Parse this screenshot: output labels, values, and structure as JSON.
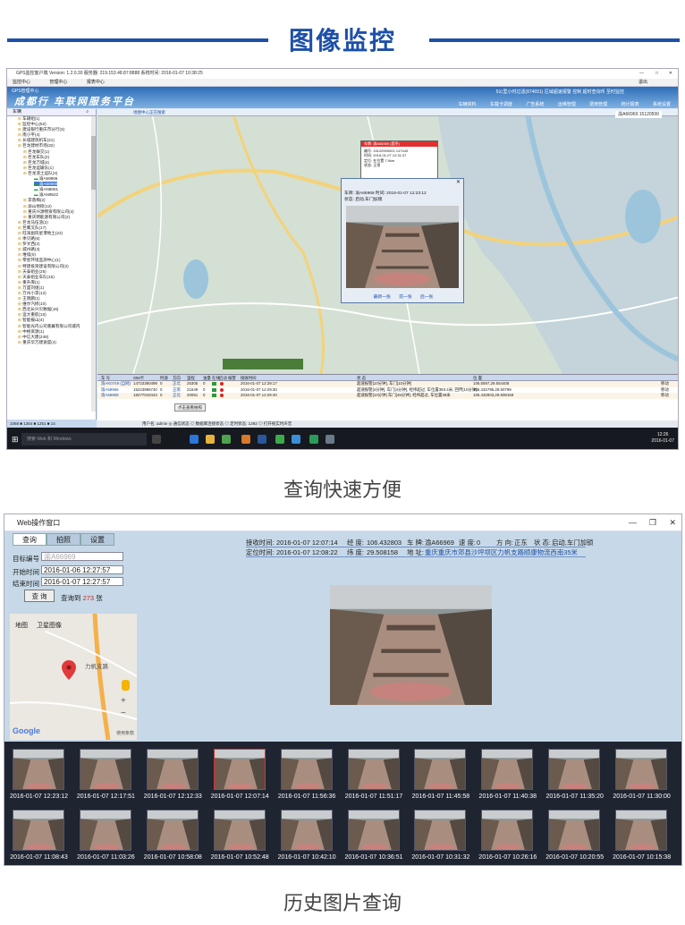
{
  "header": {
    "title": "图像监控"
  },
  "captions": {
    "top": "查询快速方便",
    "bottom": "历史图片查询"
  },
  "app1": {
    "title": "GPS监控客户端  Version: 1.2.0.30  服务器: 219.153.48.87:8888  系统时间: 2016-01-07 10:38:25",
    "menu": [
      "监控中心",
      "管理中心",
      "报表中心"
    ],
    "menu_right": "退出",
    "banner_logo": "成都行 车联网服务平台",
    "banner_sub": "GPS管理中心",
    "banner_links": "5公里小时过滤(874651) 区域超速报警  控制 超时查询币 至时监控",
    "banner_tabs": [
      "车辆资料",
      "车载卡调度",
      "广告系统",
      "运维管理",
      "费用管理",
      "统计报表",
      "系统设置"
    ],
    "tree_search": "车辆",
    "tree": [
      {
        "lvl": 1,
        "t": "车辆组(1)"
      },
      {
        "lvl": 1,
        "t": "监控中心(52)"
      },
      {
        "lvl": 1,
        "t": "建设银行重庆市分行(3)"
      },
      {
        "lvl": 1,
        "t": "南小平(4)"
      },
      {
        "lvl": 1,
        "t": "长城建筑机车(21)"
      },
      {
        "lvl": 1,
        "t": "巨龙建材市场(32)"
      },
      {
        "lvl": 2,
        "t": "巨龙联交(1)"
      },
      {
        "lvl": 2,
        "t": "巨龙车队(2)"
      },
      {
        "lvl": 2,
        "t": "巨龙万城(4)"
      },
      {
        "lvl": 2,
        "t": "巨龙运输队(1)"
      },
      {
        "lvl": 2,
        "t": "巨龙渣土运队(4)"
      },
      {
        "lvl": 3,
        "t": "渝A59966"
      },
      {
        "lvl": 3,
        "t": "渝A66969",
        "sel": true
      },
      {
        "lvl": 3,
        "t": "渝AN8061"
      },
      {
        "lvl": 3,
        "t": "渝AN9522"
      },
      {
        "lvl": 2,
        "t": "李蓉梅(2)"
      },
      {
        "lvl": 2,
        "t": "渝山地街(12)"
      },
      {
        "lvl": 2,
        "t": "重庆兴源物资有限公司(4)"
      },
      {
        "lvl": 2,
        "t": "重庆明能源有限公司(2)"
      },
      {
        "lvl": 1,
        "t": "巨龙马伍渣(2)"
      },
      {
        "lvl": 1,
        "t": "巨鹰叉队(17)"
      },
      {
        "lvl": 1,
        "t": "旺泽副风星港地土(22)"
      },
      {
        "lvl": 1,
        "t": "季贝路(6)"
      },
      {
        "lvl": 1,
        "t": "罗文西(2)"
      },
      {
        "lvl": 1,
        "t": "城州路(3)"
      },
      {
        "lvl": 1,
        "t": "堆墙(0)"
      },
      {
        "lvl": 1,
        "t": "零星环境监测中心(1)"
      },
      {
        "lvl": 1,
        "t": "特建投资建设有限公司(2)"
      },
      {
        "lvl": 1,
        "t": "天泰组业(25)"
      },
      {
        "lvl": 1,
        "t": "天泰组业车队(15)"
      },
      {
        "lvl": 1,
        "t": "重升库(1)"
      },
      {
        "lvl": 1,
        "t": "万盛刘组(1)"
      },
      {
        "lvl": 1,
        "t": "万州小李(12)"
      },
      {
        "lvl": 1,
        "t": "王晓鹏(1)"
      },
      {
        "lvl": 1,
        "t": "维尔汽修(10)"
      },
      {
        "lvl": 1,
        "t": "西北长兴贝数据(16)"
      },
      {
        "lvl": 1,
        "t": "运大重航(10)"
      },
      {
        "lvl": 1,
        "t": "智能报山(4)"
      },
      {
        "lvl": 1,
        "t": "智能光内公司重翼有限公司城内"
      },
      {
        "lvl": 1,
        "t": "中格资源(1)"
      },
      {
        "lvl": 1,
        "t": "中信大建(248)"
      },
      {
        "lvl": 1,
        "t": "重庆华万建速度(4)"
      }
    ],
    "tree_status": "1068  ■ 1364  ■ 1251  ■ 14",
    "map_toolbar": "地图中心正在搜索",
    "plate_box": "渝A66969  15120500",
    "popup": {
      "head": "车牌: 渝A66969 (套序)",
      "lines": [
        "编号: 15120900001  147443",
        "时间: 2016-01-07 12:31:37",
        "定位: 在位置 7.9km",
        "状态: 正常"
      ]
    },
    "photo_dlg": {
      "line1": "车牌: 渝A66969    时间: 2016-01-07 12:23:12",
      "line2": "状态: 启动,车门加锁",
      "buttons": [
        "最新一张",
        "前一张",
        "后一张"
      ]
    },
    "grid": {
      "headers": [
        "车 号",
        "SIM卡",
        "时速",
        "方向",
        "里程",
        "油量",
        "在线",
        "启动",
        "报警",
        "接收时间",
        "状 态",
        "位 置"
      ],
      "rows": [
        {
          "plate": "渝AK0749 (自网)",
          "sim": "14723390499",
          "speed": "0",
          "dir": "正北",
          "mile": "25305",
          "oil": "0",
          "time": "2016-01-07 12:29:17",
          "status": "超速报警[10分钟], 车门[10分钟]",
          "pos": "106.5597,29.554408",
          "extra": "移动"
        },
        {
          "plate": "渝A59966",
          "sim": "15223995740",
          "speed": "0",
          "dir": "正南",
          "mile": "21649",
          "oil": "0",
          "time": "2016-01-07 12:29:30",
          "status": "超速报警[4分钟], 车门[4分钟], 经纬超过, 车位置393.4米, 回传[10分钟]",
          "pos": "106.432795,29.50799",
          "extra": "移动"
        },
        {
          "plate": "渝A66969",
          "sim": "18277043443",
          "speed": "0",
          "dir": "正北",
          "mile": "20051",
          "oil": "0",
          "time": "2016-01-07 12:29:40",
          "status": "超速报警[10分钟] 车门[45分钟], 经纬超过, 车位置38米",
          "pos": "106.432803,29.508158",
          "extra": "移动"
        }
      ]
    },
    "status_bar": "用户名: admin   ◎ 通信状态   ◎ 数据库连接状态   ◎ 定时状态: 1392   ◎ 打开视实时声音",
    "snap_button": "点击查看拍照",
    "taskbar_search": "搜索 Web 和 Windows",
    "clock": {
      "time": "12:26",
      "date": "2016-01-07"
    }
  },
  "app2": {
    "title": "Web操作窗口",
    "tabs": [
      "查询",
      "拍照",
      "设置"
    ],
    "form": {
      "target_label": "目标编号",
      "target_value": "渝A66969",
      "start_label": "开始时间",
      "start_value": "2016-01-06 12:27:57",
      "end_label": "结束时间",
      "end_value": "2016-01-07 12:27:57",
      "query_button": "查 询",
      "result_prefix": "查询到",
      "result_count": "273",
      "result_suffix": "张"
    },
    "minimap": {
      "tab_map": "地图",
      "tab_sat": "卫星图像",
      "place": "力帆支路",
      "brand": "Google",
      "footer": "使用条款"
    },
    "info": {
      "recv_label": "接收时间:",
      "recv": "2016-01-07 12:07:14",
      "lng_label": "经 度:",
      "lng": "106.432803",
      "plate_label": "车 牌:",
      "plate": "渝A66969",
      "spd_label": "速 度:",
      "spd": "0",
      "dir_label": "方 向:",
      "dir": "正东",
      "state_label": "状 态:",
      "state": "启动,车门加锁",
      "pos_label": "定位时间:",
      "pos_time": "2016-01-07 12:08:22",
      "lat_label": "纬 度:",
      "lat": "29.508158",
      "addr_label": "地 址:",
      "addr": "重庆重庆市郊县沙坪坝区力帆支路顺康物流西南35米"
    },
    "thumbs": [
      "2016-01-07 12:23:12",
      "2016-01-07 12:17:51",
      "2016-01-07 12:12:33",
      "2016-01-07 12:07:14",
      "2016-01-07 11:56:36",
      "2016-01-07 11:51:17",
      "2016-01-07 11:45:58",
      "2016-01-07 11:40:38",
      "2016-01-07 11:35:20",
      "2016-01-07 11:30:00",
      "2016-01-07 11:08:43",
      "2016-01-07 11:03:26",
      "2016-01-07 10:58:08",
      "2016-01-07 10:52:48",
      "2016-01-07 10:42:10",
      "2016-01-07 10:36:51",
      "2016-01-07 10:31:32",
      "2016-01-07 10:26:16",
      "2016-01-07 10:20:55",
      "2016-01-07 10:15:38"
    ],
    "selected_thumb": 3
  }
}
